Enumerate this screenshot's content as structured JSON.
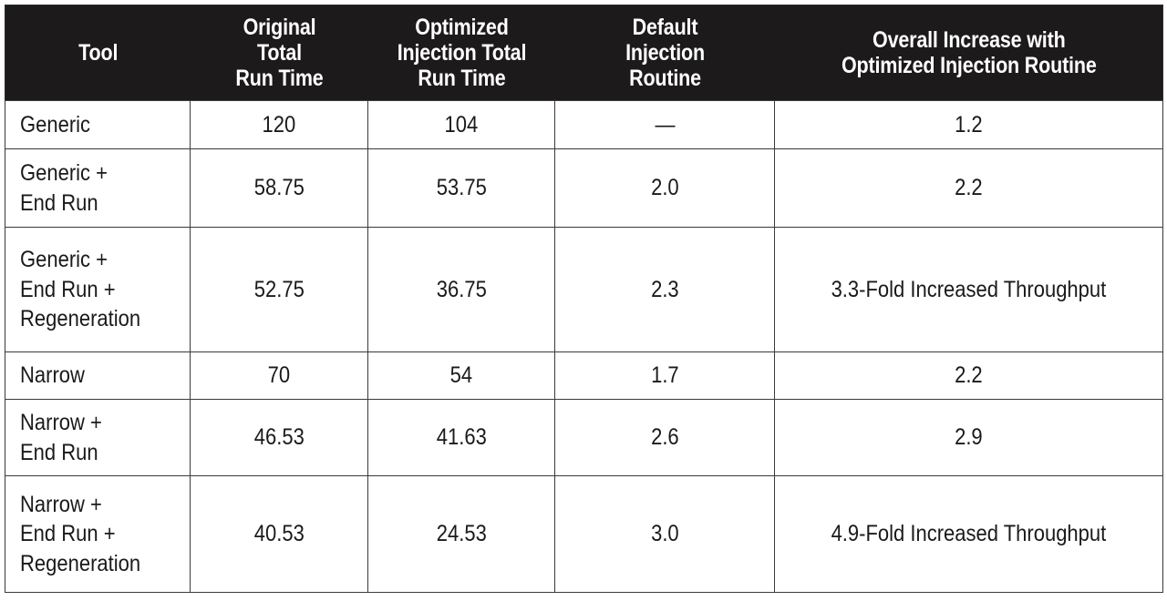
{
  "table": {
    "header": {
      "background_color": "#1c1a1a",
      "text_color": "#ffffff",
      "columns": [
        {
          "key": "tool",
          "lines": [
            "Tool"
          ]
        },
        {
          "key": "original",
          "lines": [
            "Original",
            "Total",
            "Run Time"
          ]
        },
        {
          "key": "optimized",
          "lines": [
            "Optimized",
            "Injection Total",
            "Run Time"
          ]
        },
        {
          "key": "default",
          "lines": [
            "Default",
            "Injection",
            "Routine"
          ]
        },
        {
          "key": "overall",
          "lines": [
            "Overall Increase with",
            "Optimized Injection Routine"
          ]
        }
      ]
    },
    "border_color": "#3b3939",
    "rows": [
      {
        "tool": "Generic",
        "original_total_run_time": "120",
        "optimized_injection_total_run_time": "104",
        "default_injection_routine": "—",
        "overall_increase": "1.2"
      },
      {
        "tool": "Generic +\nEnd Run",
        "original_total_run_time": "58.75",
        "optimized_injection_total_run_time": "53.75",
        "default_injection_routine": "2.0",
        "overall_increase": "2.2"
      },
      {
        "tool": "Generic +\nEnd Run +\nRegeneration",
        "original_total_run_time": "52.75",
        "optimized_injection_total_run_time": "36.75",
        "default_injection_routine": "2.3",
        "overall_increase": "3.3-Fold Increased Throughput"
      },
      {
        "tool": "Narrow",
        "original_total_run_time": "70",
        "optimized_injection_total_run_time": "54",
        "default_injection_routine": "1.7",
        "overall_increase": "2.2"
      },
      {
        "tool": "Narrow +\nEnd Run",
        "original_total_run_time": "46.53",
        "optimized_injection_total_run_time": "41.63",
        "default_injection_routine": "2.6",
        "overall_increase": "2.9"
      },
      {
        "tool": "Narrow +\nEnd Run +\nRegeneration",
        "original_total_run_time": "40.53",
        "optimized_injection_total_run_time": "24.53",
        "default_injection_routine": "3.0",
        "overall_increase": "4.9-Fold Increased Throughput"
      }
    ]
  }
}
